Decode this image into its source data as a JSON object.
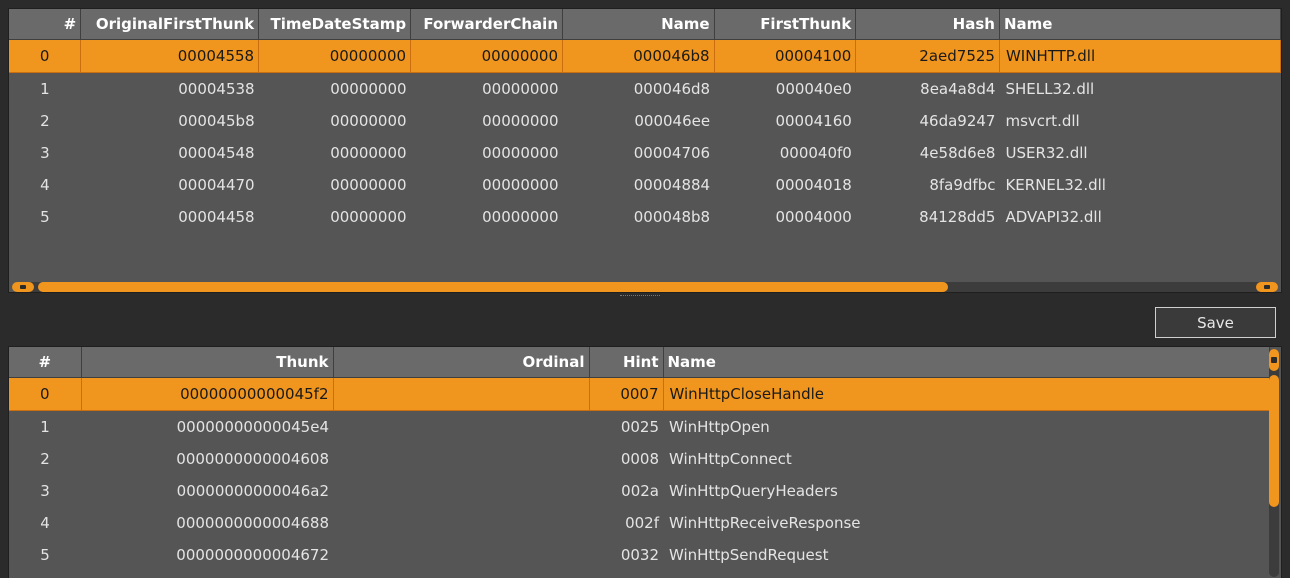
{
  "imports_table": {
    "columns": [
      "#",
      "OriginalFirstThunk",
      "TimeDateStamp",
      "ForwarderChain",
      "Name",
      "FirstThunk",
      "Hash",
      "Name"
    ],
    "rows": [
      [
        "0",
        "00004558",
        "00000000",
        "00000000",
        "000046b8",
        "00004100",
        "2aed7525",
        "WINHTTP.dll"
      ],
      [
        "1",
        "00004538",
        "00000000",
        "00000000",
        "000046d8",
        "000040e0",
        "8ea4a8d4",
        "SHELL32.dll"
      ],
      [
        "2",
        "000045b8",
        "00000000",
        "00000000",
        "000046ee",
        "00004160",
        "46da9247",
        "msvcrt.dll"
      ],
      [
        "3",
        "00004548",
        "00000000",
        "00000000",
        "00004706",
        "000040f0",
        "4e58d6e8",
        "USER32.dll"
      ],
      [
        "4",
        "00004470",
        "00000000",
        "00000000",
        "00004884",
        "00004018",
        "8fa9dfbc",
        "KERNEL32.dll"
      ],
      [
        "5",
        "00004458",
        "00000000",
        "00000000",
        "000048b8",
        "00004000",
        "84128dd5",
        "ADVAPI32.dll"
      ]
    ],
    "selected_row": 0
  },
  "toolbar": {
    "save_label": "Save"
  },
  "functions_table": {
    "columns": [
      "#",
      "Thunk",
      "Ordinal",
      "Hint",
      "Name"
    ],
    "rows": [
      [
        "0",
        "00000000000045f2",
        "",
        "0007",
        "WinHttpCloseHandle"
      ],
      [
        "1",
        "00000000000045e4",
        "",
        "0025",
        "WinHttpOpen"
      ],
      [
        "2",
        "0000000000004608",
        "",
        "0008",
        "WinHttpConnect"
      ],
      [
        "3",
        "00000000000046a2",
        "",
        "002a",
        "WinHttpQueryHeaders"
      ],
      [
        "4",
        "0000000000004688",
        "",
        "002f",
        "WinHttpReceiveResponse"
      ],
      [
        "5",
        "0000000000004672",
        "",
        "0032",
        "WinHttpSendRequest"
      ]
    ],
    "selected_row": 0
  },
  "colors": {
    "accent": "#f0951e",
    "panel_bg": "#555555",
    "header_bg": "#6a6a6a",
    "window_bg": "#2b2b2b"
  }
}
